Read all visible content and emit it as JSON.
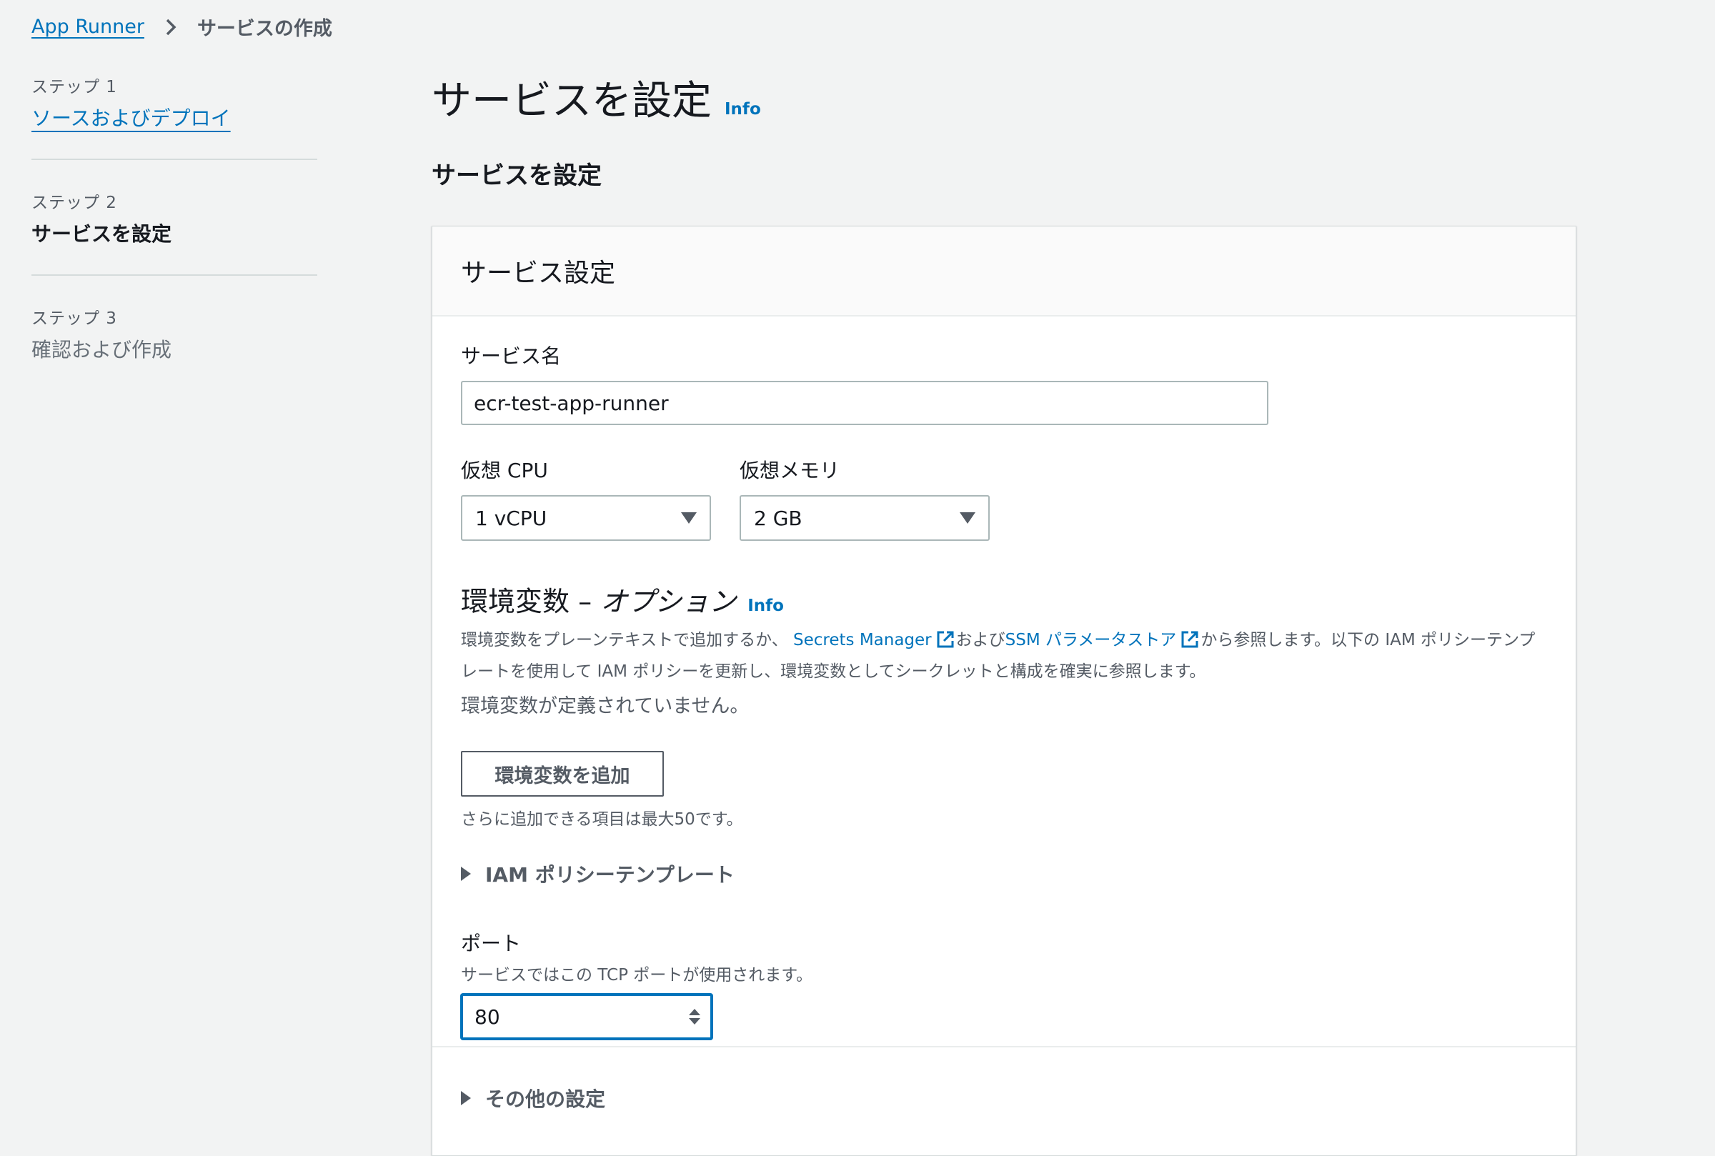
{
  "breadcrumb": {
    "root": "App Runner",
    "current": "サービスの作成"
  },
  "steps": [
    {
      "label": "ステップ 1",
      "title": "ソースおよびデプロイ"
    },
    {
      "label": "ステップ 2",
      "title": "サービスを設定"
    },
    {
      "label": "ステップ 3",
      "title": "確認および作成"
    }
  ],
  "page": {
    "title": "サービスを設定",
    "info": "Info",
    "section_title": "サービスを設定"
  },
  "card": {
    "header": "サービス設定",
    "service_name": {
      "label": "サービス名",
      "value": "ecr-test-app-runner"
    },
    "cpu": {
      "label": "仮想 CPU",
      "value": "1 vCPU"
    },
    "memory": {
      "label": "仮想メモリ",
      "value": "2 GB"
    },
    "env": {
      "title": "環境変数",
      "dash": " – ",
      "optional": "オプション",
      "info": "Info",
      "desc_part1": "環境変数をプレーンテキストで追加するか、",
      "secrets_link": "Secrets Manager",
      "desc_part2": "および",
      "ssm_link": "SSM パラメータストア",
      "desc_part3": "から参照します。以下の IAM ポリシーテンプレートを使用して IAM ポリシーを更新し、環境変数としてシークレットと構成を確実に参照します。",
      "empty": "環境変数が定義されていません。",
      "add_button": "環境変数を追加",
      "limit_hint": "さらに追加できる項目は最大50です。"
    },
    "iam_expander": "IAM ポリシーテンプレート",
    "port": {
      "label": "ポート",
      "description": "サービスではこの TCP ポートが使用されます。",
      "value": "80"
    },
    "other_expander": "その他の設定"
  }
}
